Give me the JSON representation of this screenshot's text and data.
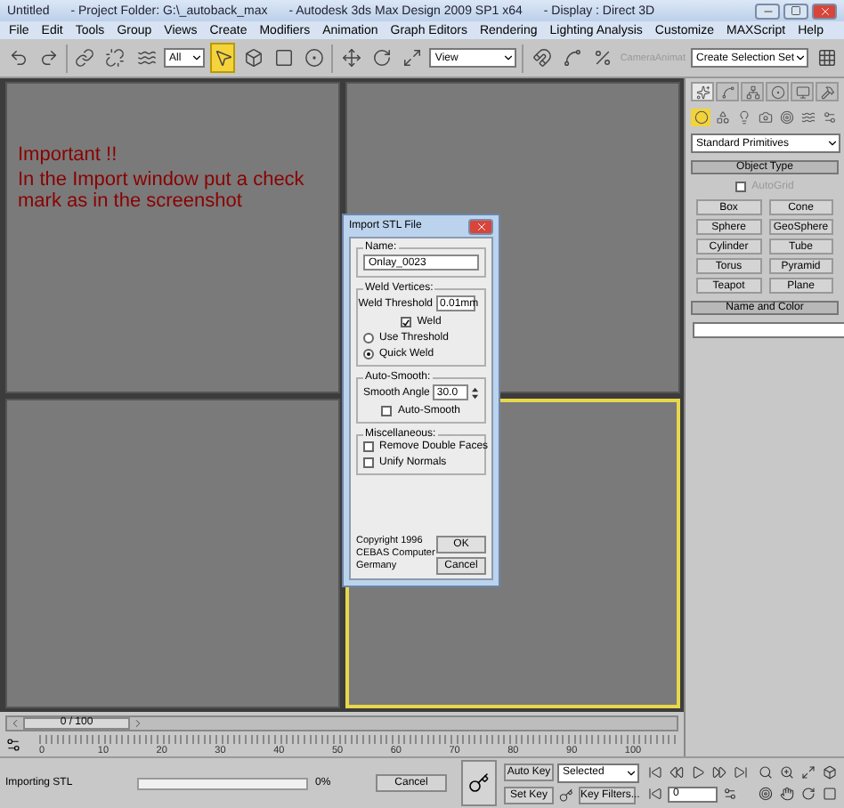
{
  "window": {
    "title": [
      "Untitled",
      "- Project Folder: G:\\_autoback_max",
      "- Autodesk 3ds Max Design 2009 SP1  x64",
      "- Display : Direct 3D"
    ]
  },
  "menu": [
    "File",
    "Edit",
    "Tools",
    "Group",
    "Views",
    "Create",
    "Modifiers",
    "Animation",
    "Graph Editors",
    "Rendering",
    "Lighting Analysis",
    "Customize",
    "MAXScript",
    "Help"
  ],
  "toolbar": {
    "filter": "All",
    "select_tool": {
      "selected": true
    },
    "view": "View",
    "camera_label": "CameraAnimat",
    "named_selection": "Create Selection Set"
  },
  "viewports": [
    {
      "active": false,
      "note": {
        "heading": "Important !!",
        "text": "In the Import window put a check mark as in the screenshot"
      }
    },
    {
      "active": false
    },
    {
      "active": false
    },
    {
      "active": true
    }
  ],
  "command_panel": {
    "category": "Standard Primitives",
    "object_type": {
      "title": "Object Type",
      "autogrid": {
        "label": "AutoGrid",
        "checked": false,
        "disabled": true
      },
      "buttons": [
        "Box",
        "Cone",
        "Sphere",
        "GeoSphere",
        "Cylinder",
        "Tube",
        "Torus",
        "Pyramid",
        "Teapot",
        "Plane"
      ]
    },
    "name_and_color": {
      "title": "Name and Color"
    }
  },
  "dialog": {
    "title": "Import STL File",
    "name": {
      "label": "Name:",
      "value": "Onlay_0023"
    },
    "weld": {
      "label": "Weld Vertices:",
      "threshold_label": "Weld Threshold",
      "threshold": "0.01mm",
      "weld": {
        "label": "Weld",
        "checked": true
      },
      "options": [
        {
          "label": "Use Threshold",
          "selected": false
        },
        {
          "label": "Quick Weld",
          "selected": true
        }
      ]
    },
    "auto_smooth": {
      "label": "Auto-Smooth:",
      "angle_label": "Smooth Angle",
      "angle": "30.0",
      "auto_smooth": {
        "label": "Auto-Smooth",
        "checked": false
      }
    },
    "misc": {
      "label": "Miscellaneous:",
      "options": [
        {
          "label": "Remove Double Faces",
          "checked": false
        },
        {
          "label": "Unify Normals",
          "checked": false
        }
      ]
    },
    "copyright": [
      "Copyright 1996",
      "CEBAS Computer",
      "Germany"
    ],
    "buttons": [
      "OK",
      "Cancel"
    ]
  },
  "time_slider": {
    "label": "0 / 100",
    "level": 0
  },
  "ruler": [
    "0",
    "10",
    "20",
    "30",
    "40",
    "50",
    "60",
    "70",
    "80",
    "90",
    "100"
  ],
  "status": {
    "message": "Importing STL",
    "progress": {
      "level": 0,
      "reading": "0%"
    },
    "cancel": "Cancel",
    "auto_key": "Auto Key",
    "key_mode": "Selected",
    "set_key": "Set Key",
    "key_filters": "Key Filters...",
    "frame": "0"
  }
}
